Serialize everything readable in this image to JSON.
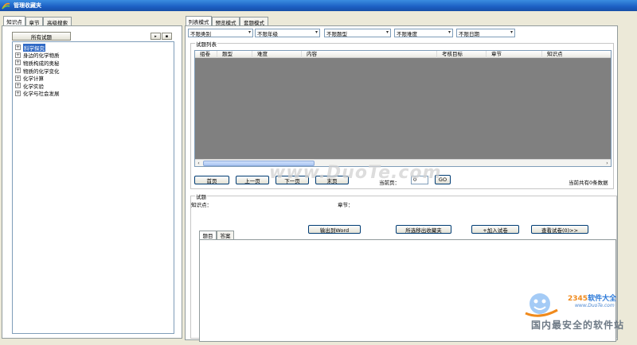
{
  "window": {
    "title": "管理收藏夹"
  },
  "left_tabs": [
    "知识点",
    "章节",
    "高级搜索"
  ],
  "left_panel": {
    "all_button": "所有试题",
    "mini_buttons": [
      "▸",
      "▪"
    ],
    "tree": [
      {
        "label": "科学探究",
        "selected": true
      },
      {
        "label": "身边的化学物质",
        "selected": false
      },
      {
        "label": "物质构成的奥秘",
        "selected": false
      },
      {
        "label": "物质的化学变化",
        "selected": false
      },
      {
        "label": "化学计算",
        "selected": false
      },
      {
        "label": "化学实验",
        "selected": false
      },
      {
        "label": "化学与社会发展",
        "selected": false
      }
    ]
  },
  "right_tabs": [
    "列表模式",
    "预览模式",
    "套题模式"
  ],
  "filters": [
    "不限类别",
    "不限年级",
    "不限题型",
    "不限难度",
    "不限日期"
  ],
  "list_section": {
    "legend": "试题列表",
    "columns": [
      "组卷",
      "题型",
      "难度",
      "内容",
      "考核目标",
      "章节",
      "知识点"
    ]
  },
  "pager": {
    "first": "首页",
    "prev": "上一页",
    "next": "下一页",
    "last": "末页",
    "current_label": "当前页：",
    "current_value": "0",
    "go": "GO",
    "total": "当前共有0条数据"
  },
  "detail_section": {
    "legend": "试题",
    "knowledge_label": "知识点：",
    "chapter_label": "章节：",
    "knowledge_value": "",
    "chapter_value": "",
    "tabs": [
      "题目",
      "答案"
    ],
    "buttons": {
      "export_word": "输出到Word",
      "remove_fav": "所选移出收藏夹",
      "add_paper": "+加入试卷",
      "view_paper": "查看试卷(0)>>"
    }
  },
  "watermarks": {
    "center": "www.DuoTe.com",
    "brand_blue": "2345",
    "brand_rest": "软件大全",
    "url": "www.DuoTe.com",
    "slogan": "国内最安全的软件站"
  },
  "colors": {
    "titlebar": "#1c5fc4",
    "grid_bg": "#808080",
    "selection": "#316ac5"
  }
}
